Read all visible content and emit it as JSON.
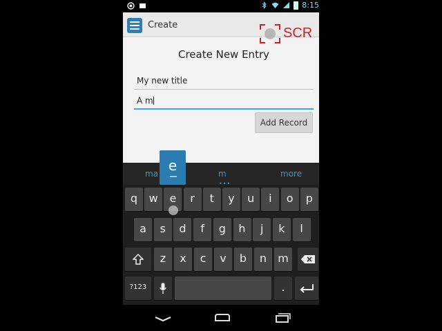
{
  "status_bar": {
    "time": "8:15",
    "icons": [
      "screen-recorder-icon",
      "notification-icon",
      "bluetooth-icon",
      "wifi-icon",
      "signal-icon",
      "battery-icon"
    ]
  },
  "action_bar": {
    "title": "Create",
    "icon": "list-app-icon"
  },
  "watermark": {
    "text": "SCR",
    "color": "#cc2222"
  },
  "form": {
    "heading": "Create New Entry",
    "title_value": "My new title",
    "body_value": "A m",
    "submit_label": "Add Record",
    "accent_color": "#3aa8d8"
  },
  "keyboard": {
    "suggestions": [
      "ma",
      "m",
      "more"
    ],
    "popup_key": "e",
    "rows": [
      [
        "q",
        "w",
        "e",
        "r",
        "t",
        "y",
        "u",
        "i",
        "o",
        "p"
      ],
      [
        "a",
        "s",
        "d",
        "f",
        "g",
        "h",
        "j",
        "k",
        "l"
      ],
      [
        "z",
        "x",
        "c",
        "v",
        "b",
        "n",
        "m"
      ]
    ],
    "symbols_label": "?123",
    "period_label": ".",
    "accent_color": "#2b7cb1"
  },
  "nav_bar": {
    "buttons": [
      "back-icon",
      "home-icon",
      "recent-apps-icon"
    ]
  }
}
